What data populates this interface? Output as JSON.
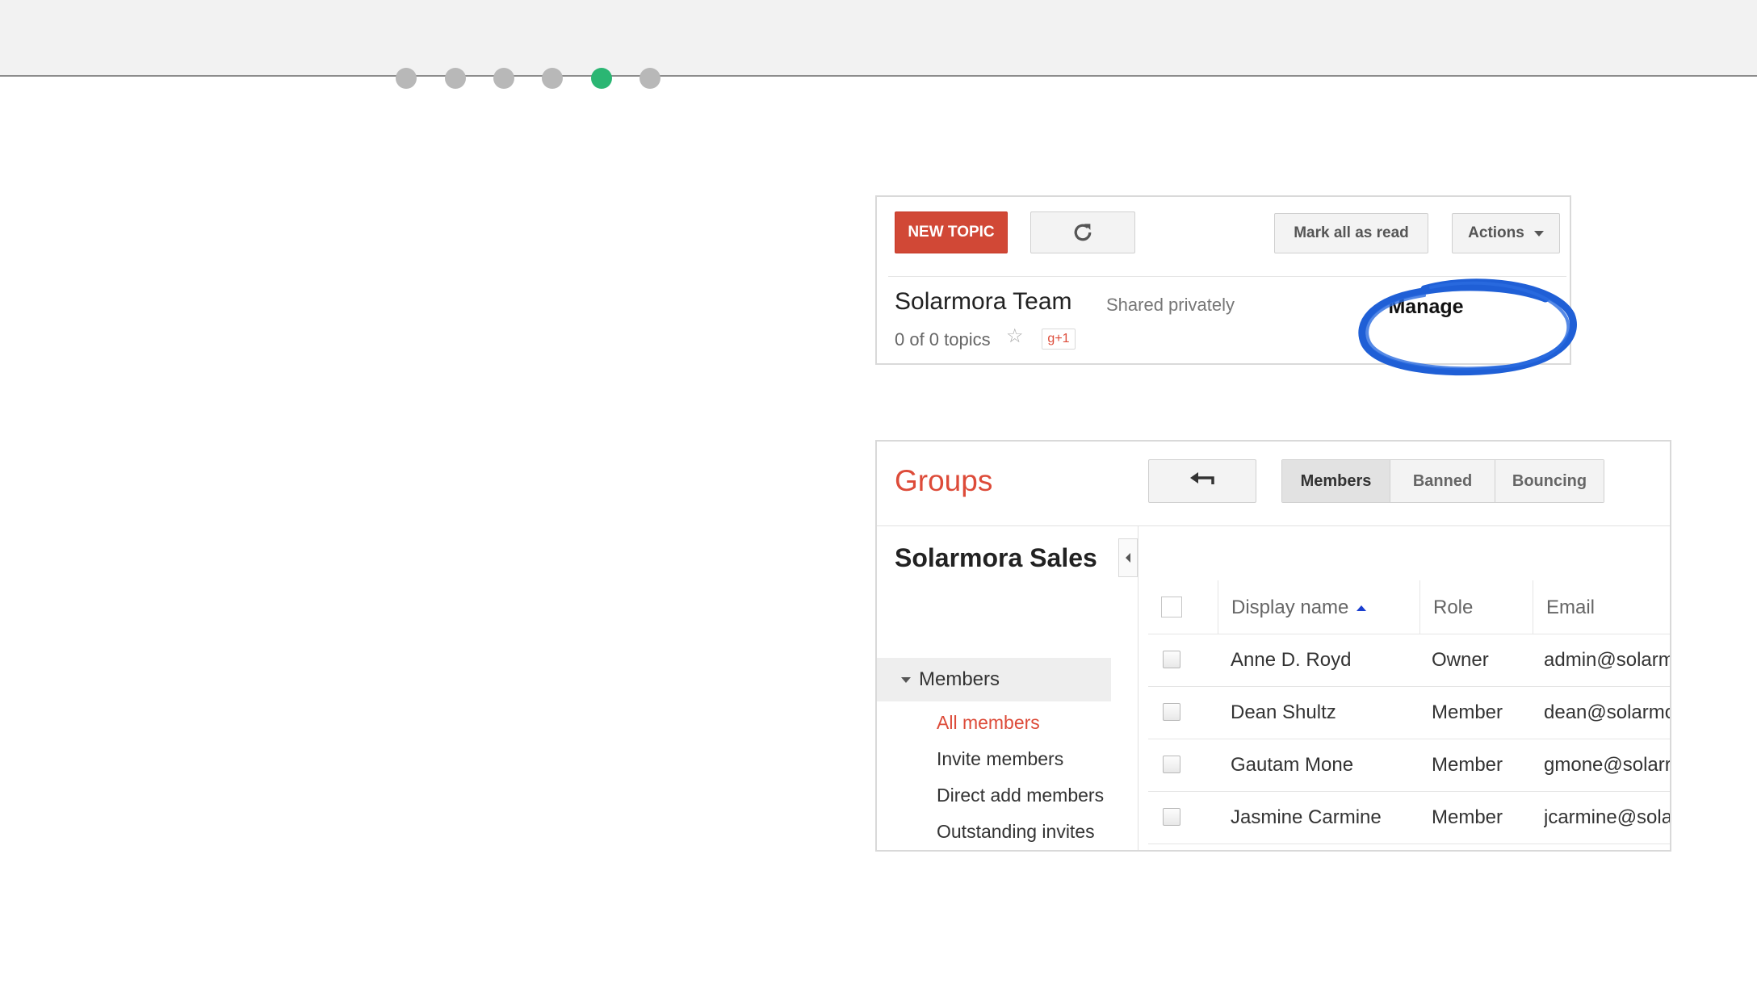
{
  "progress": {
    "total_steps": 6,
    "current_step": 5,
    "active_color": "#2bb673"
  },
  "forum": {
    "new_topic_label": "NEW TOPIC",
    "refresh_icon": "refresh-icon",
    "mark_read_label": "Mark all as read",
    "actions_label": "Actions",
    "group_name": "Solarmora Team",
    "sharing": "Shared privately",
    "topic_count": "0 of 0 topics",
    "plus_one_label": "g+1",
    "manage_label": "Manage",
    "highlight_color": "#1f5fd6"
  },
  "settings": {
    "title": "Groups",
    "back_icon": "back-arrow-icon",
    "tabs": [
      {
        "label": "Members"
      },
      {
        "label": "Banned"
      },
      {
        "label": "Bouncing"
      }
    ],
    "group_name": "Solarmora Sales",
    "nav_section": "Members",
    "nav_items": [
      {
        "label": "All members"
      },
      {
        "label": "Invite members"
      },
      {
        "label": "Direct add members"
      },
      {
        "label": "Outstanding invites"
      }
    ],
    "columns": {
      "name": "Display name",
      "role": "Role",
      "email": "Email"
    },
    "members": [
      {
        "name": "Anne D. Royd",
        "role": "Owner",
        "email": "admin@solarm"
      },
      {
        "name": "Dean Shultz",
        "role": "Member",
        "email": "dean@solarmo"
      },
      {
        "name": "Gautam Mone",
        "role": "Member",
        "email": "gmone@solarr"
      },
      {
        "name": "Jasmine Carmine",
        "role": "Member",
        "email": "jcarmine@sola"
      }
    ]
  }
}
